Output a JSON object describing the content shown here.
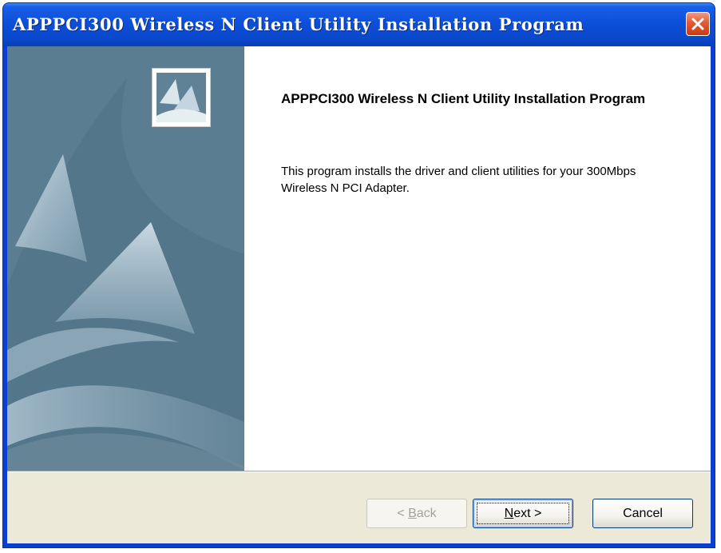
{
  "window": {
    "title": "APPPCI300 Wireless N Client Utility Installation Program"
  },
  "content": {
    "heading": "APPPCI300 Wireless N Client Utility Installation Program",
    "description": "This program installs the driver and client utilities for your 300Mbps Wireless N PCI Adapter."
  },
  "buttons": {
    "back": {
      "prefix": "< ",
      "mnemonic": "B",
      "rest": "ack",
      "enabled": false
    },
    "next": {
      "mnemonic": "N",
      "rest": "ext >",
      "enabled": true
    },
    "cancel": {
      "label": "Cancel",
      "enabled": true
    }
  },
  "colors": {
    "titlebar": "#0a48cc",
    "close_button": "#e25a33",
    "dialog_face": "#ece9d8",
    "banner": "#5a7c90"
  },
  "icons": {
    "close": "close-x-icon",
    "logo": "sail-logo-icon",
    "banner_art": "sail-banner-graphic"
  }
}
